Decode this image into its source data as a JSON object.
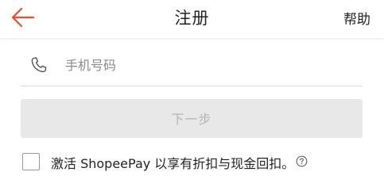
{
  "header": {
    "title": "注册",
    "help_label": "帮助",
    "back_icon": "arrow-left-icon",
    "accent_color": "#ee4d2d"
  },
  "phone_field": {
    "icon": "phone-icon",
    "placeholder": "手机号码",
    "value": ""
  },
  "next_button": {
    "label": "下一步"
  },
  "shopeepay_option": {
    "checked": false,
    "label": "激活 ShopeePay 以享有折扣与现金回扣。",
    "info_icon": "question-circle-icon"
  }
}
